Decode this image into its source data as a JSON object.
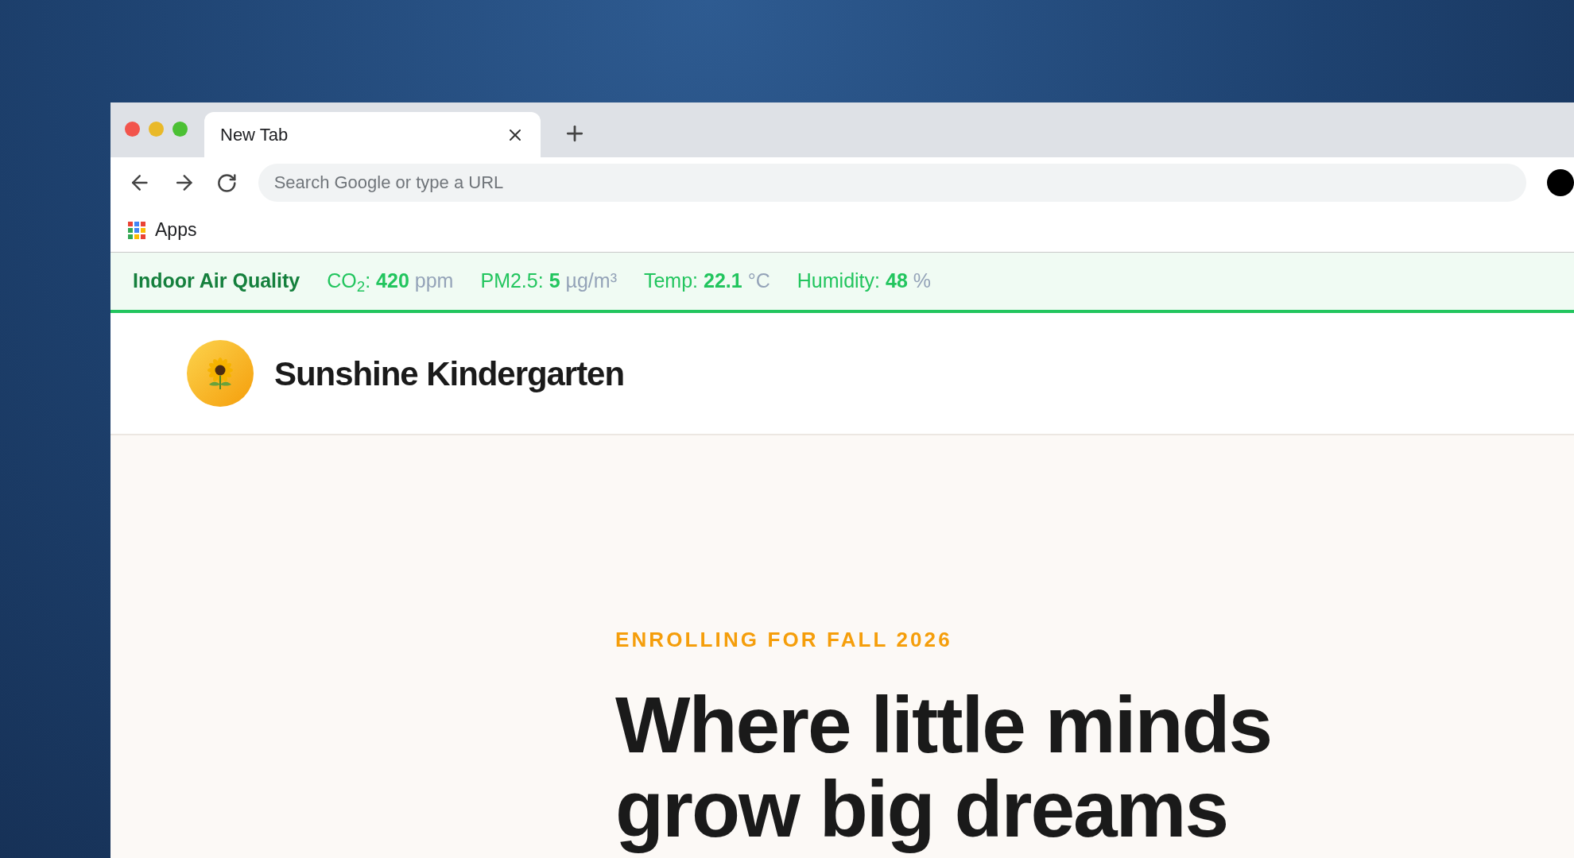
{
  "browser": {
    "tab": {
      "title": "New Tab"
    },
    "address_bar": {
      "placeholder": "Search Google or type a URL"
    },
    "bookmarks": [
      {
        "label": "Apps"
      }
    ]
  },
  "air_quality_bar": {
    "title": "Indoor Air Quality",
    "readings": [
      {
        "label": "CO$_{2}$:",
        "value": "420",
        "unit": "ppm"
      },
      {
        "label": "PM2.5:",
        "value": "5",
        "unit": "µg/m³"
      },
      {
        "label": "Temp:",
        "value": "22.1",
        "unit": "°C"
      },
      {
        "label": "Humidity:",
        "value": "48",
        "unit": "%"
      }
    ]
  },
  "site_header": {
    "school_name": "Sunshine Kindergarten"
  },
  "hero": {
    "kicker": "ENROLLING FOR FALL 2026",
    "headline_lines": [
      "Where little minds",
      "grow big dreams"
    ]
  }
}
